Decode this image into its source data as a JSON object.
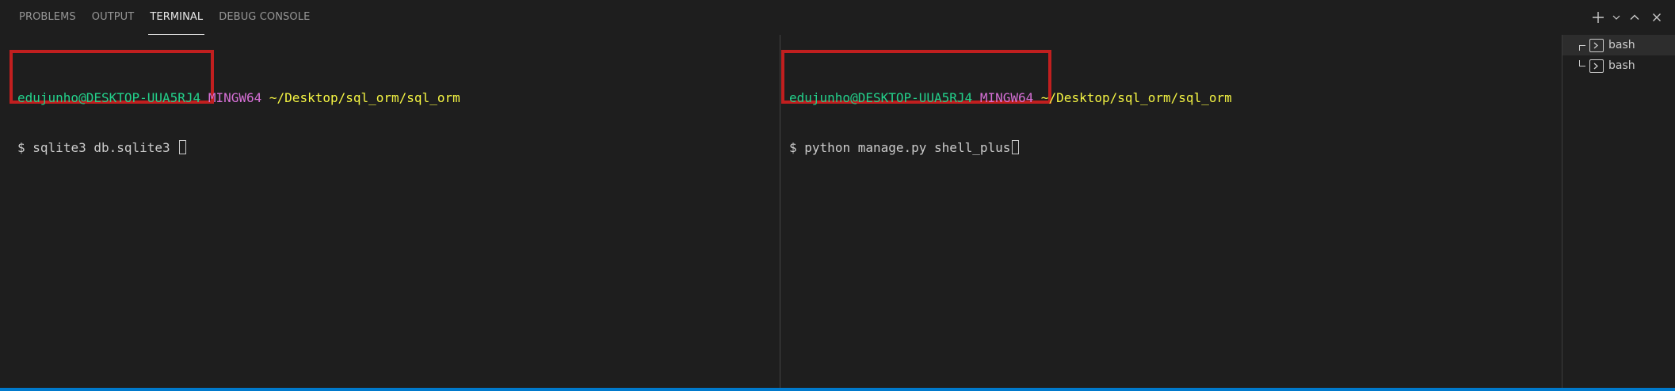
{
  "panel": {
    "tabs": [
      {
        "label": "PROBLEMS",
        "active": false
      },
      {
        "label": "OUTPUT",
        "active": false
      },
      {
        "label": "TERMINAL",
        "active": true
      },
      {
        "label": "DEBUG CONSOLE",
        "active": false
      }
    ],
    "actions": [
      {
        "icon": "plus-icon"
      },
      {
        "icon": "chevron-down-icon"
      },
      {
        "icon": "chevron-up-icon"
      },
      {
        "icon": "close-icon"
      }
    ]
  },
  "terminals": {
    "left": {
      "user_host": "edujunho@DESKTOP-UUA5RJ4",
      "system": "MINGW64",
      "path": "~/Desktop/sql_orm/sql_orm",
      "prompt": "$",
      "command": "sqlite3 db.sqlite3"
    },
    "right": {
      "user_host": "edujunho@DESKTOP-UUA5RJ4",
      "system": "MINGW64",
      "path": "~/Desktop/sql_orm/sql_orm",
      "prompt": "$",
      "command": "python manage.py shell_plus"
    }
  },
  "terminal_list": [
    {
      "label": "bash",
      "icon": "terminal-icon",
      "active": true
    },
    {
      "label": "bash",
      "icon": "terminal-icon",
      "active": false
    }
  ],
  "colors": {
    "background": "#1e1e1e",
    "user": "#23d18b",
    "system": "#d670d6",
    "path": "#f5f543",
    "highlight": "#c11f1f",
    "accent": "#007acc"
  }
}
